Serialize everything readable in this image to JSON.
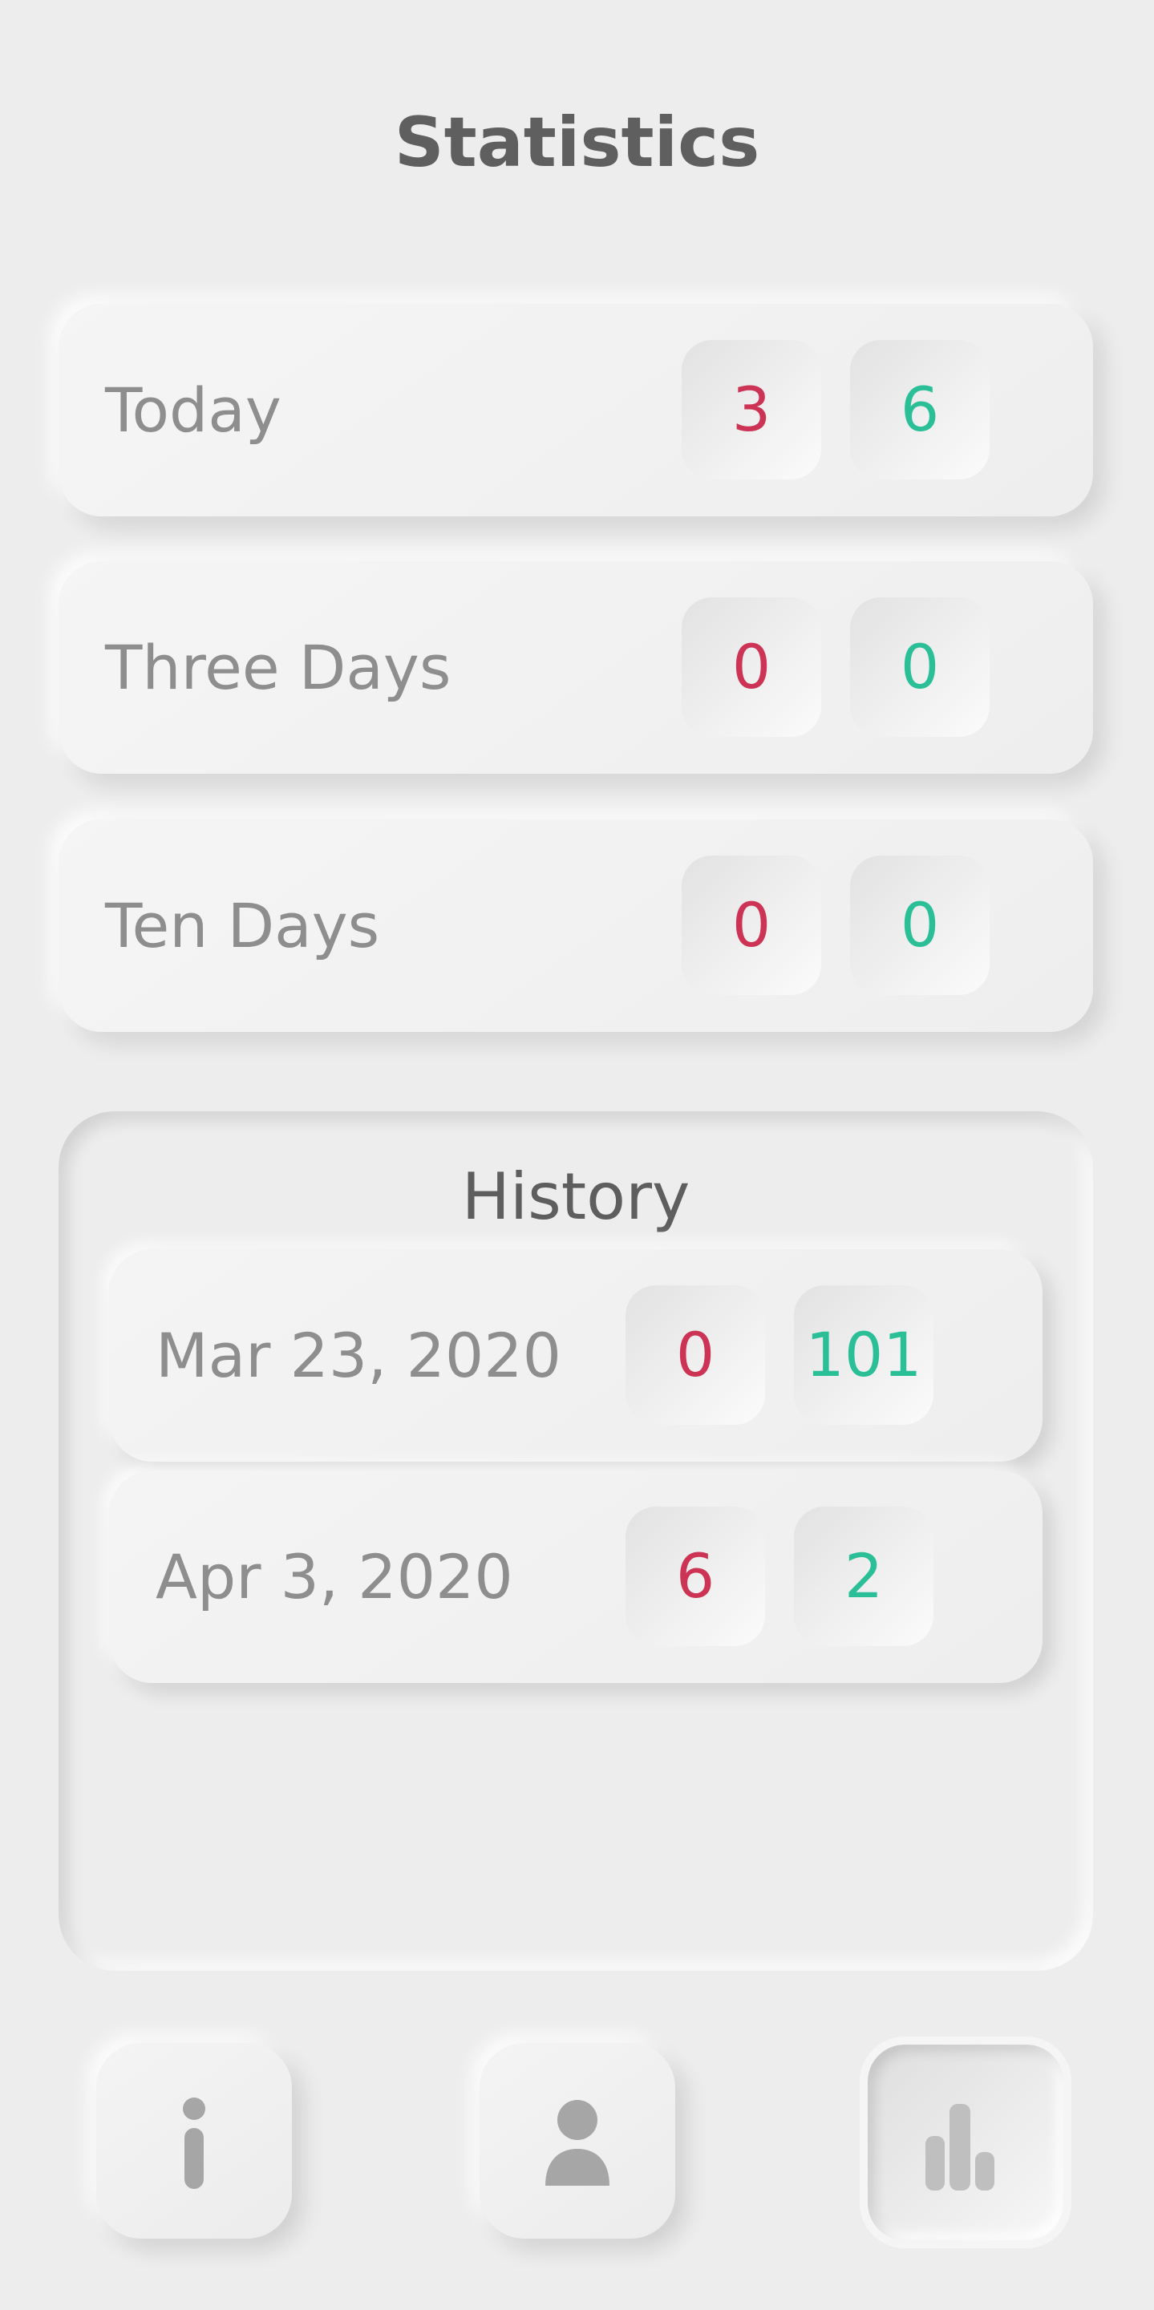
{
  "header": {
    "title": "Statistics"
  },
  "summary": [
    {
      "label": "Today",
      "red": "3",
      "green": "6"
    },
    {
      "label": "Three Days",
      "red": "0",
      "green": "0"
    },
    {
      "label": "Ten Days",
      "red": "0",
      "green": "0"
    }
  ],
  "history": {
    "title": "History",
    "items": [
      {
        "date": "Mar 23, 2020",
        "red": "0",
        "green": "101"
      },
      {
        "date": "Apr 3, 2020",
        "red": "6",
        "green": "2"
      }
    ]
  },
  "nav": {
    "items": [
      {
        "icon": "info-icon",
        "active": false
      },
      {
        "icon": "user-icon",
        "active": false
      },
      {
        "icon": "bar-chart-icon",
        "active": true
      }
    ]
  },
  "colors": {
    "background": "#ededed",
    "red": "#cc3354",
    "green": "#2bbf98",
    "icon": "#a6a6a6"
  }
}
